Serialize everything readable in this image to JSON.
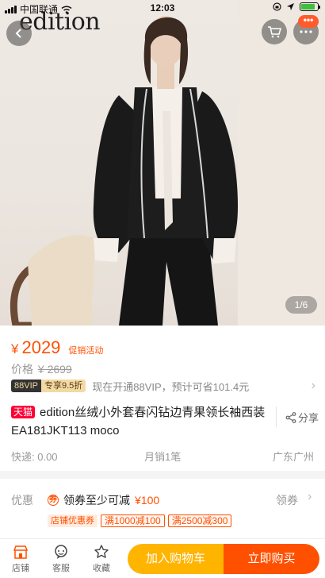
{
  "status_bar": {
    "carrier": "中国联通",
    "time": "12:03"
  },
  "product_image": {
    "brand_logo": "edition",
    "page_indicator": "1/6"
  },
  "header": {
    "more_badge": "•••"
  },
  "price": {
    "currency_symbol": "¥",
    "current": "2029",
    "promo_label": "促销活动",
    "original_label": "价格",
    "original_value": "¥ 2699"
  },
  "vip": {
    "tag_left": "88VIP",
    "tag_right": "专享9.5折",
    "text": "现在开通88VIP，预计可省101.4元"
  },
  "title": {
    "badge": "天猫",
    "text": "edition丝绒小外套春闪钻边青果领长袖西装EA181JKT113 moco",
    "share_label": "分享"
  },
  "shipping": {
    "delivery": "快递: 0.00",
    "monthly_sales": "月销1笔",
    "location": "广东广州"
  },
  "coupon": {
    "label": "优惠",
    "icon": "券",
    "text": "领券至少可减",
    "amount": "¥100",
    "action": "领券",
    "store_tag": "店铺优惠券",
    "tags": [
      "满1000减100",
      "满2500减300"
    ]
  },
  "bottom_bar": {
    "store": "店铺",
    "service": "客服",
    "favorite": "收藏",
    "add_to_cart": "加入购物车",
    "buy_now": "立即购买"
  },
  "colors": {
    "accent": "#ff5000",
    "cart_button": "#ffb400",
    "tmall_red": "#ff0036"
  }
}
